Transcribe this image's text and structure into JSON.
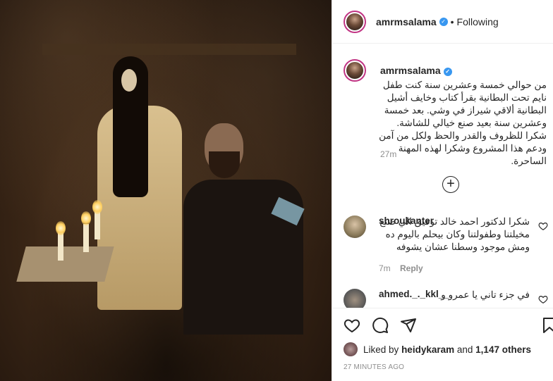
{
  "post": {
    "username": "amrmsalama",
    "verified_badge": "✓",
    "separator": "•",
    "follow_status": "Following"
  },
  "caption": {
    "username": "amrmsalama",
    "text": "من حوالي خمسة وعشرين سنة كنت طفل نايم تحت البطانية بقرأ كتاب وخايف أشيل البطانية ألاقي شيراز في وشي. بعد خمسة وعشرين سنة بعيد صنع خيالي للشاشة. شكرا للظروف والقدر والحظ ولكل من آمن ودعم هذا المشروع وشكرا لهذه المهنة الساحرة.",
    "time": "27m"
  },
  "load_more": "+",
  "comments": [
    {
      "username": "shroukanter",
      "text": "شكرا لدكتور احمد خالد توفيق الي صنع مخيلتنا وطفولتنا وكان بيحلم باليوم ده ومش موجود وسطنا عشان يشوفه",
      "time": "7m",
      "reply": "Reply"
    },
    {
      "username": "ahmed._._kkl__",
      "text": "في جزء تاني يا عمرو و"
    }
  ],
  "likes": {
    "prefix": "Liked by",
    "user": "heidykaram",
    "and": "and",
    "count": "1,147 others"
  },
  "timestamp": "27 MINUTES AGO",
  "colors": {
    "verified": "#3897f0",
    "meta": "#8e8e8e",
    "story_ring": "#c13584"
  }
}
